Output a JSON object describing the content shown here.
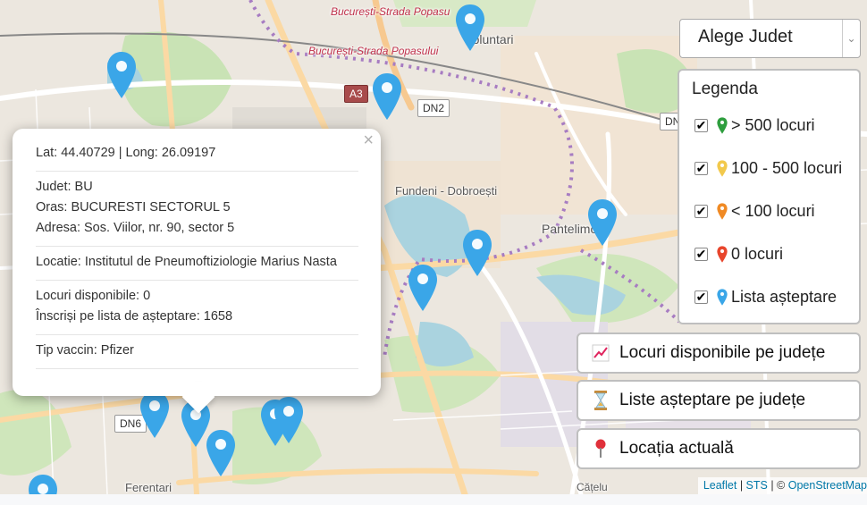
{
  "map": {
    "labels": {
      "strada_popasului_1": "București-Strada Popasu",
      "strada_popasului_2": "București-Strada Popasului",
      "voluntari": "Voluntari",
      "fundeni": "Fundeni - Dobroești",
      "pantelimon": "Pantelimon",
      "ferentari": "Ferentari",
      "catelu": "Cățelu"
    },
    "shields": {
      "a3": "A3",
      "dn2": "DN2",
      "dn6": "DN6",
      "dn": "DN"
    }
  },
  "popup": {
    "latlong": "Lat: 44.40729 | Long: 26.09197",
    "judet": "Judet: BU",
    "oras": "Oras: BUCURESTI SECTORUL 5",
    "adresa": "Adresa: Sos. Viilor, nr. 90, sector 5",
    "locatie": "Locatie: Institutul de Pneumoftiziologie Marius Nasta",
    "locuri": "Locuri disponibile: 0",
    "inscrisi": "Înscriși pe lista de așteptare: 1658",
    "tip": "Tip vaccin: Pfizer",
    "close_symbol": "×"
  },
  "select": {
    "value": "Alege Judet"
  },
  "legend": {
    "title": "Legenda",
    "items": [
      {
        "label": "> 500 locuri",
        "color": "#2e9e3e"
      },
      {
        "label": "100 - 500 locuri",
        "color": "#f2c94c"
      },
      {
        "label": "< 100 locuri",
        "color": "#f08a24"
      },
      {
        "label": "0 locuri",
        "color": "#e8452c"
      },
      {
        "label": "Lista așteptare",
        "color": "#3aa6e8"
      }
    ]
  },
  "buttons": {
    "locuri": "Locuri disponibile pe județe",
    "liste": "Liste așteptare pe județe",
    "locatia": "Locația actuală"
  },
  "attribution": {
    "leaflet": "Leaflet",
    "sep1": " | ",
    "sts": "STS",
    "sep2": " | © ",
    "osm": "OpenStreetMap"
  },
  "colors": {
    "marker_blue": "#3aa6e8"
  }
}
